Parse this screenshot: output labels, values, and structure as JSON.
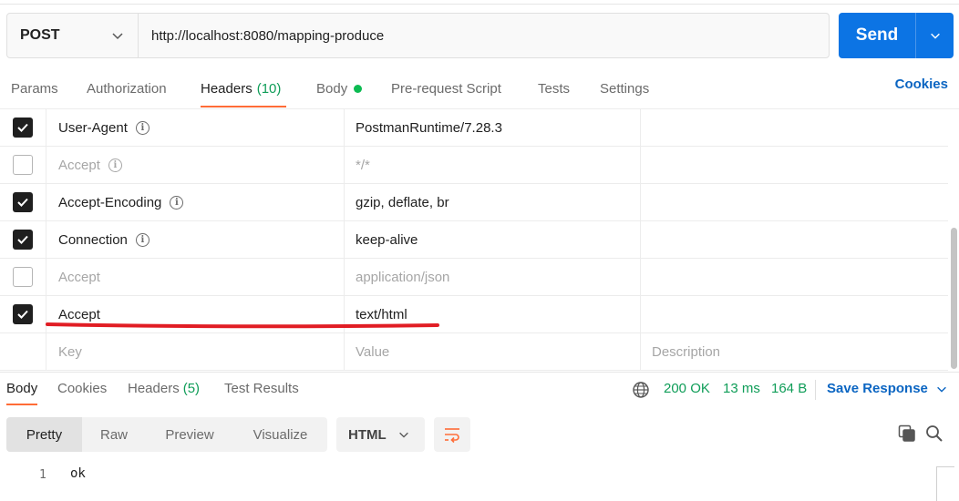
{
  "request": {
    "method": "POST",
    "url": "http://localhost:8080/mapping-produce",
    "send_label": "Send"
  },
  "tabs": [
    {
      "label": "Params"
    },
    {
      "label": "Authorization"
    },
    {
      "label": "Headers",
      "count": "(10)"
    },
    {
      "label": "Body"
    },
    {
      "label": "Pre-request Script"
    },
    {
      "label": "Tests"
    },
    {
      "label": "Settings"
    }
  ],
  "cookies_label": "Cookies",
  "headers": [
    {
      "key": "User-Agent",
      "value": "PostmanRuntime/7.28.3",
      "checked": true,
      "info": true
    },
    {
      "key": "Accept",
      "value": "*/*",
      "checked": false,
      "info": true
    },
    {
      "key": "Accept-Encoding",
      "value": "gzip, deflate, br",
      "checked": true,
      "info": true
    },
    {
      "key": "Connection",
      "value": "keep-alive",
      "checked": true,
      "info": true
    },
    {
      "key": "Accept",
      "value": "application/json",
      "checked": false,
      "info": false
    },
    {
      "key": "Accept",
      "value": "text/html",
      "checked": true,
      "info": false
    }
  ],
  "placeholder_row": {
    "key": "Key",
    "value": "Value",
    "description": "Description"
  },
  "response": {
    "tabs": [
      {
        "label": "Body"
      },
      {
        "label": "Cookies"
      },
      {
        "label": "Headers",
        "count": "(5)"
      },
      {
        "label": "Test Results"
      }
    ],
    "status": "200 OK",
    "time": "13 ms",
    "size": "164 B",
    "save_label": "Save Response"
  },
  "view": {
    "modes": [
      "Pretty",
      "Raw",
      "Preview",
      "Visualize"
    ],
    "format": "HTML"
  },
  "body_lines": [
    {
      "number": "1",
      "text": "ok"
    }
  ],
  "colors": {
    "accent": "#ff6c37",
    "send": "#0c74e4",
    "link": "#0b65c2",
    "success": "#0f9d58",
    "annotation": "#e11d24"
  }
}
